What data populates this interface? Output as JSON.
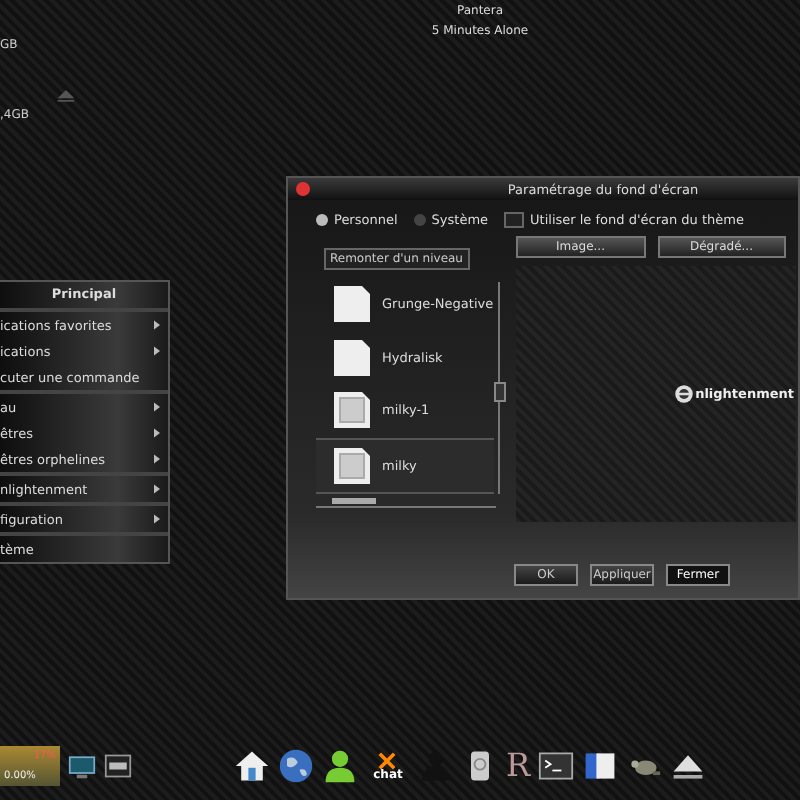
{
  "gadgets": {
    "disk_lines": [
      "GB",
      ",4GB"
    ]
  },
  "music": {
    "artist": "Pantera",
    "track": "5 Minutes Alone"
  },
  "menu": {
    "title": "Principal",
    "groups": [
      [
        {
          "label": "ications favorites",
          "submenu": true
        },
        {
          "label": "ications",
          "submenu": true
        },
        {
          "label": "cuter une commande",
          "submenu": false
        }
      ],
      [
        {
          "label": "au",
          "submenu": true
        },
        {
          "label": "êtres",
          "submenu": true
        },
        {
          "label": "êtres orphelines",
          "submenu": true
        }
      ],
      [
        {
          "label": "nlightenment",
          "submenu": true
        }
      ],
      [
        {
          "label": "figuration",
          "submenu": true
        }
      ],
      [
        {
          "label": "tème",
          "submenu": false
        }
      ]
    ]
  },
  "dialog": {
    "title": "Paramétrage du fond d'écran",
    "sources": [
      {
        "label": "Personnel",
        "selected": true
      },
      {
        "label": "Système",
        "selected": false
      }
    ],
    "use_theme": {
      "label": "Utiliser le fond d'écran du thème",
      "checked": false
    },
    "up_button": "Remonter d'un niveau",
    "image_button": "Image...",
    "gradient_button": "Dégradé...",
    "files": [
      {
        "name": "Grunge-Negative",
        "kind": "blank",
        "selected": false
      },
      {
        "name": "Hydralisk",
        "kind": "blank",
        "selected": false
      },
      {
        "name": "milky-1",
        "kind": "framed",
        "selected": false
      },
      {
        "name": "milky",
        "kind": "framed",
        "selected": true
      }
    ],
    "preview_logo": "nlightenment",
    "buttons": [
      "OK",
      "Appliquer",
      "Fermer"
    ]
  },
  "taskbar": {
    "cpu": "17%",
    "load": "0.00%",
    "chat_label": "chat",
    "letter_label": "R"
  }
}
